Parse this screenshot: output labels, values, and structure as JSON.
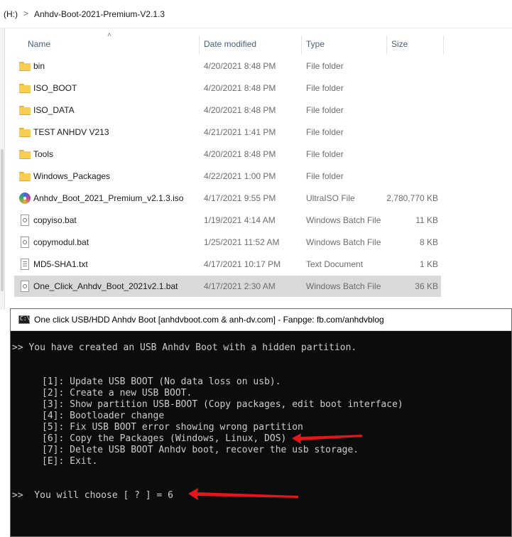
{
  "address": {
    "drive": "(H:)",
    "separator": ">",
    "folder": "Anhdv-Boot-2021-Premium-V2.1.3"
  },
  "columns": {
    "name": "Name",
    "date": "Date modified",
    "type": "Type",
    "size": "Size"
  },
  "files": [
    {
      "name": "bin",
      "date": "4/20/2021 8:48 PM",
      "type": "File folder",
      "size": "",
      "icon": "folder-icon"
    },
    {
      "name": "ISO_BOOT",
      "date": "4/20/2021 8:48 PM",
      "type": "File folder",
      "size": "",
      "icon": "folder-icon"
    },
    {
      "name": "ISO_DATA",
      "date": "4/20/2021 8:48 PM",
      "type": "File folder",
      "size": "",
      "icon": "folder-icon"
    },
    {
      "name": "TEST ANHDV V213",
      "date": "4/21/2021 1:41 PM",
      "type": "File folder",
      "size": "",
      "icon": "folder-icon"
    },
    {
      "name": "Tools",
      "date": "4/20/2021 8:48 PM",
      "type": "File folder",
      "size": "",
      "icon": "folder-icon"
    },
    {
      "name": "Windows_Packages",
      "date": "4/22/2021 1:00 PM",
      "type": "File folder",
      "size": "",
      "icon": "folder-icon"
    },
    {
      "name": "Anhdv_Boot_2021_Premium_v2.1.3.iso",
      "date": "4/17/2021 9:55 PM",
      "type": "UltraISO File",
      "size": "2,780,770 KB",
      "icon": "disc-icon"
    },
    {
      "name": "copyiso.bat",
      "date": "1/19/2021 4:14 AM",
      "type": "Windows Batch File",
      "size": "11 KB",
      "icon": "batch-file-icon"
    },
    {
      "name": "copymodul.bat",
      "date": "1/25/2021 11:52 AM",
      "type": "Windows Batch File",
      "size": "8 KB",
      "icon": "batch-file-icon"
    },
    {
      "name": "MD5-SHA1.txt",
      "date": "4/17/2021 10:17 PM",
      "type": "Text Document",
      "size": "1 KB",
      "icon": "text-file-icon"
    },
    {
      "name": "One_Click_Anhdv_Boot_2021v2.1.bat",
      "date": "4/17/2021 2:30 AM",
      "type": "Windows Batch File",
      "size": "36 KB",
      "icon": "batch-file-icon"
    }
  ],
  "console": {
    "title_icon_glyph": "C:\\",
    "title": "One click USB/HDD Anhdv Boot [anhdvboot.com & anh-dv.com] -  Fanpge: fb.com/anhdvblog",
    "status_line": ">> You have created an USB Anhdv Boot with a hidden partition.",
    "menu": [
      "[1]: Update USB BOOT (No data loss on usb).",
      "[2]: Create a new USB BOOT.",
      "[3]: Show partition USB-BOOT (Copy packages, edit boot interface)",
      "[4]: Bootloader change",
      "[5]: Fix USB BOOT error showing wrong partition",
      "[6]: Copy the Packages (Windows, Linux, DOS)",
      "[7]: Delete USB BOOT Anhdv boot, recover the usb storage.",
      "[E]: Exit."
    ],
    "prompt_line": ">>  You will choose [ ? ] = 6"
  },
  "colors": {
    "selected_row": "#d9d9d9",
    "console_bg": "#0c0c0c",
    "console_text": "#cccccc",
    "arrow": "#e3161c",
    "header_text": "#4c607a"
  }
}
